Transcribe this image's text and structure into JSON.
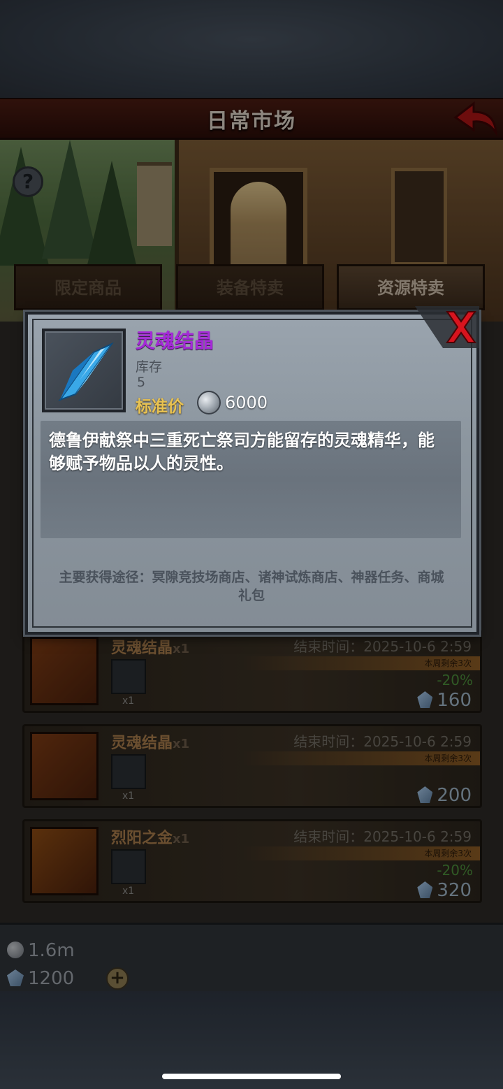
{
  "header": {
    "title": "日常市场"
  },
  "tabs": [
    {
      "label": "限定商品"
    },
    {
      "label": "装备特卖"
    },
    {
      "label": "资源特卖"
    }
  ],
  "list": {
    "items": [
      {
        "name": "灵魂结晶",
        "qty": "x1",
        "end_time": "结束时间：2025-10-6 2:59",
        "weekly_limit": "本周剩余3次",
        "mini_qty": "x1",
        "discount": "-20%",
        "price": "160"
      },
      {
        "name": "灵魂结晶",
        "qty": "x1",
        "end_time": "结束时间：2025-10-6 2:59",
        "weekly_limit": "本周剩余3次",
        "mini_qty": "x1",
        "discount": "",
        "price": "200"
      },
      {
        "name": "烈阳之金",
        "qty": "x1",
        "end_time": "结束时间：2025-10-6 2:59",
        "weekly_limit": "本周剩余3次",
        "mini_qty": "x1",
        "discount": "-20%",
        "price": "320"
      }
    ]
  },
  "footer": {
    "silver": "1.6m",
    "gems": "1200"
  },
  "modal": {
    "item_name": "灵魂结晶",
    "stock_label": "库存",
    "stock_value": "5",
    "price_label": "标准价",
    "price_value": "6000",
    "description": "德鲁伊献祭中三重死亡祭司方能留存的灵魂精华，能够赋予物品以人的灵性。",
    "source": "主要获得途径：冥隙竞技场商店、诸神试炼商店、神器任务、商城礼包"
  },
  "colors": {
    "item_name": "#a52ad8",
    "price_label": "#e8c252",
    "close_red": "#d8141e",
    "back_red": "#b01818"
  },
  "icons": [
    "back-arrow-icon",
    "help-icon",
    "close-icon",
    "crystal-icon",
    "silver-coin-icon",
    "gem-icon",
    "plus-icon"
  ]
}
